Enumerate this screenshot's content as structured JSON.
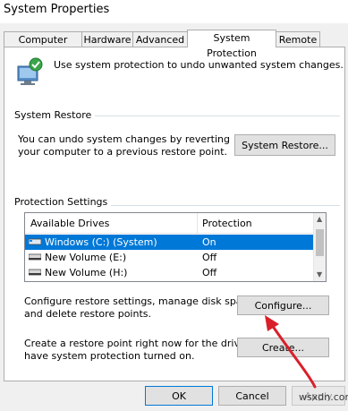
{
  "window": {
    "title": "System Properties"
  },
  "tabs": [
    {
      "label": "Computer Name"
    },
    {
      "label": "Hardware"
    },
    {
      "label": "Advanced"
    },
    {
      "label": "System Protection",
      "active": true
    },
    {
      "label": "Remote"
    }
  ],
  "intro": {
    "text": "Use system protection to undo unwanted system changes.",
    "icon": "system-shield-icon"
  },
  "system_restore": {
    "group_title": "System Restore",
    "desc_line1": "You can undo system changes by reverting",
    "desc_line2": "your computer to a previous restore point.",
    "button_label": "System Restore..."
  },
  "protection": {
    "group_title": "Protection Settings",
    "columns": {
      "drives": "Available Drives",
      "protection": "Protection"
    },
    "drives": [
      {
        "name": "Windows (C:) (System)",
        "protection": "On",
        "selected": true
      },
      {
        "name": "New Volume (E:)",
        "protection": "Off"
      },
      {
        "name": "New Volume (H:)",
        "protection": "Off"
      }
    ],
    "configure_desc_line1": "Configure restore settings, manage disk space,",
    "configure_desc_line2": "and delete restore points.",
    "configure_label": "Configure...",
    "create_desc_line1": "Create a restore point right now for the drives that",
    "create_desc_line2": "have system protection turned on.",
    "create_label": "Create..."
  },
  "footer": {
    "ok_label": "OK",
    "cancel_label": "Cancel",
    "apply_label": "Apply"
  },
  "watermark": "wsxdn.com",
  "colors": {
    "selection": "#0078d7",
    "annotation_arrow": "#d9202a"
  }
}
